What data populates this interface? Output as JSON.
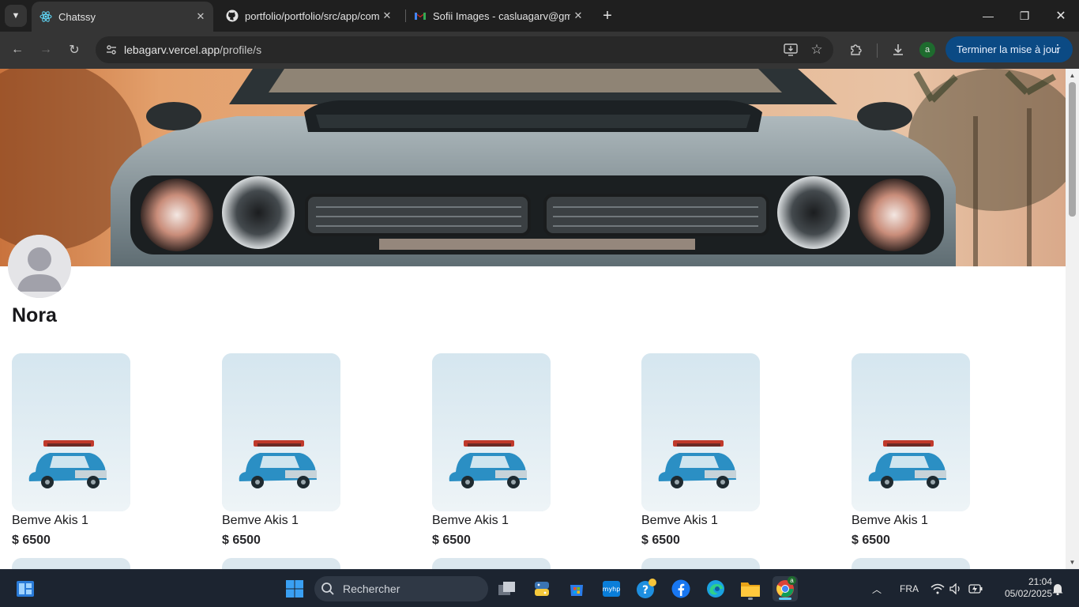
{
  "browser": {
    "tabs": [
      {
        "title": "Chatssy",
        "icon": "react-icon",
        "active": true
      },
      {
        "title": "portfolio/portfolio/src/app/com",
        "icon": "github-icon",
        "active": false
      },
      {
        "title": "Sofii Images - casluagarv@gma",
        "icon": "gmail-icon",
        "active": false
      }
    ],
    "url_host": "lebagarv.vercel.app",
    "url_path": "/profile/s",
    "profile_initial": "a",
    "update_label": "Terminer la mise à jour"
  },
  "profile": {
    "name": "Nora"
  },
  "products": [
    {
      "name": "Bemve Akis 1",
      "price": "$ 6500"
    },
    {
      "name": "Bemve Akis 1",
      "price": "$ 6500"
    },
    {
      "name": "Bemve Akis 1",
      "price": "$ 6500"
    },
    {
      "name": "Bemve Akis 1",
      "price": "$ 6500"
    },
    {
      "name": "Bemve Akis 1",
      "price": "$ 6500"
    }
  ],
  "taskbar": {
    "search_label": "Rechercher",
    "language": "FRA",
    "time": "21:04",
    "date": "05/02/2025",
    "chrome_badge": "a"
  },
  "colors": {
    "accent": "#0b4a84",
    "browser_chrome": "#353535",
    "page_bg": "#ffffff"
  }
}
